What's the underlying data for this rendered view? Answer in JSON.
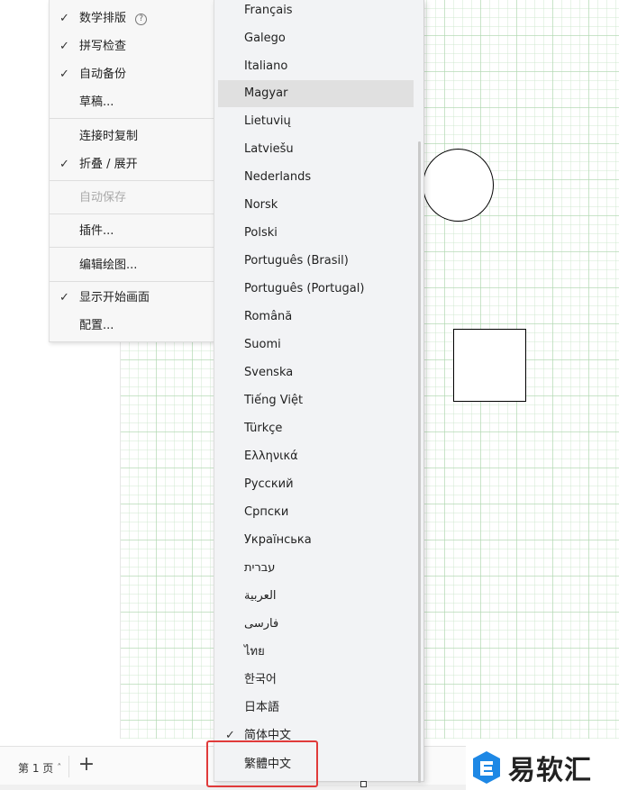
{
  "canvas": {
    "grid_color": "#b0d8b0"
  },
  "left_menu": {
    "items": [
      {
        "label": "数学排版",
        "checked": true,
        "help": "?"
      },
      {
        "label": "拼写检查",
        "checked": true
      },
      {
        "label": "自动备份",
        "checked": true
      },
      {
        "label": "草稿...",
        "checked": false
      },
      {
        "label": "连接时复制",
        "checked": false
      },
      {
        "label": "折叠 / 展开",
        "checked": true
      },
      {
        "label": "自动保存",
        "checked": false,
        "disabled": true
      },
      {
        "label": "插件...",
        "checked": false
      },
      {
        "label": "编辑绘图...",
        "checked": false
      },
      {
        "label": "显示开始画面",
        "checked": true
      },
      {
        "label": "配置...",
        "checked": false
      }
    ]
  },
  "language_menu": {
    "items": [
      {
        "label": "Français"
      },
      {
        "label": "Galego"
      },
      {
        "label": "Italiano"
      },
      {
        "label": "Magyar",
        "hover": true
      },
      {
        "label": "Lietuvių"
      },
      {
        "label": "Latviešu"
      },
      {
        "label": "Nederlands"
      },
      {
        "label": "Norsk"
      },
      {
        "label": "Polski"
      },
      {
        "label": "Português (Brasil)"
      },
      {
        "label": "Português (Portugal)"
      },
      {
        "label": "Română"
      },
      {
        "label": "Suomi"
      },
      {
        "label": "Svenska"
      },
      {
        "label": "Tiếng Việt"
      },
      {
        "label": "Türkçe"
      },
      {
        "label": "Ελληνικά"
      },
      {
        "label": "Русский"
      },
      {
        "label": "Српски"
      },
      {
        "label": "Українська"
      },
      {
        "label": "עברית"
      },
      {
        "label": "العربية"
      },
      {
        "label": "فارسی"
      },
      {
        "label": "ไทย"
      },
      {
        "label": "한국어"
      },
      {
        "label": "日本語"
      },
      {
        "label": "简体中文",
        "checked": true
      },
      {
        "label": "繁體中文",
        "highlighted": true
      }
    ]
  },
  "bottom_bar": {
    "page_tab": "第 1 页",
    "add_page": "+"
  },
  "watermark": {
    "text": "易软汇",
    "icon_color": "#1e88e5"
  },
  "icons": {
    "check": "✓",
    "chevron": "˄"
  }
}
